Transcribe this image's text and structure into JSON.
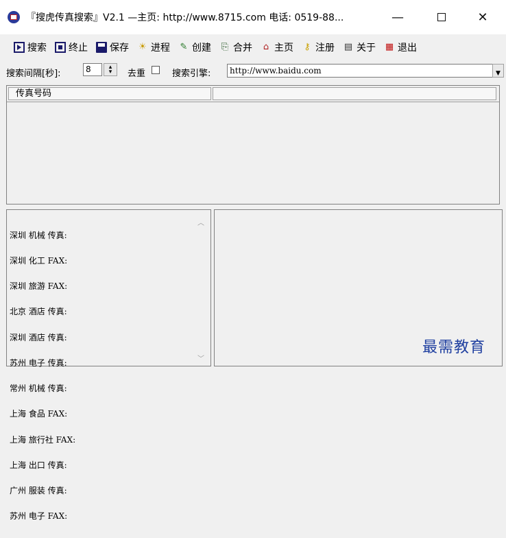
{
  "window": {
    "title": "『搜虎传真搜索』V2.1 —主页: http://www.8715.com 电话: 0519-88...",
    "minimize": "—",
    "close": "✕"
  },
  "toolbar": [
    {
      "label": "搜索",
      "icon": "play-icon"
    },
    {
      "label": "终止",
      "icon": "stop-icon"
    },
    {
      "label": "保存",
      "icon": "save-icon"
    },
    {
      "label": "进程",
      "icon": "bulb-icon"
    },
    {
      "label": "创建",
      "icon": "create-icon"
    },
    {
      "label": "合并",
      "icon": "merge-icon"
    },
    {
      "label": "主页",
      "icon": "home-icon"
    },
    {
      "label": "注册",
      "icon": "key-icon"
    },
    {
      "label": "关于",
      "icon": "about-icon"
    },
    {
      "label": "退出",
      "icon": "exit-icon"
    }
  ],
  "settings": {
    "interval_label": "搜索间隔[秒]:",
    "interval_value": "8",
    "dedupe_label": "去重",
    "dedupe_checked": false,
    "engine_label": "搜索引擎:",
    "engine_value": "http://www.baidu.com"
  },
  "list": {
    "column1": "传真号码",
    "column2": ""
  },
  "keywords": [
    "深圳 机械 传真:",
    "深圳 化工 FAX:",
    "深圳 旅游 FAX:",
    "北京 酒店 传真:",
    "深圳 酒店 传真:",
    "苏州 电子 传真:",
    "常州 机械 传真:",
    "上海 食品 FAX:",
    "上海 旅行社 FAX:",
    "上海 出口 传真:",
    "广州 服装 传真:",
    "苏州 电子 FAX:"
  ],
  "watermark": "最需教育"
}
